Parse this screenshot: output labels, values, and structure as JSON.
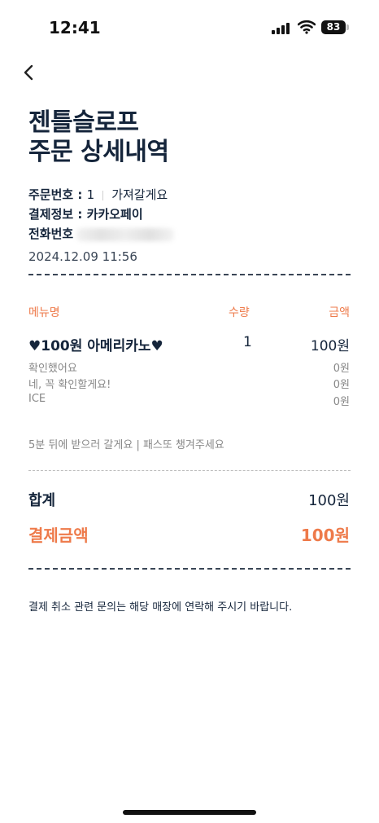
{
  "status_bar": {
    "time": "12:41",
    "battery": "83"
  },
  "header": {
    "title_line1": "젠틀슬로프",
    "title_line2": "주문 상세내역"
  },
  "order_info": {
    "order_no_label": "주문번호 : ",
    "order_no": "1",
    "order_type": "가져갈게요",
    "payment_label": "결제정보 : ",
    "payment_method": "카카오페이",
    "phone_label": "전화번호",
    "datetime": "2024.12.09 11:56"
  },
  "columns": {
    "menu": "메뉴명",
    "qty": "수량",
    "amount": "금액"
  },
  "items": [
    {
      "name": "♥100원 아메리카노♥",
      "qty": "1",
      "price": "100원",
      "options": [
        {
          "name": "확인했어요",
          "price": "0원"
        },
        {
          "name": "네, 꼭 확인할게요!",
          "price": "0원"
        },
        {
          "name": "ICE",
          "price": "0원"
        }
      ]
    }
  ],
  "request_note": "5분 뒤에 받으러 갈게요 | 패스또 챙겨주세요",
  "totals": {
    "sum_label": "합계",
    "sum_value": "100원",
    "payment_label": "결제금액",
    "payment_value": "100원"
  },
  "footer_note": "결제 취소 관련 문의는 해당 매장에 연락해 주시기 바랍니다.",
  "colors": {
    "accent": "#ee7a4a",
    "text": "#15253b",
    "muted": "#888888"
  }
}
